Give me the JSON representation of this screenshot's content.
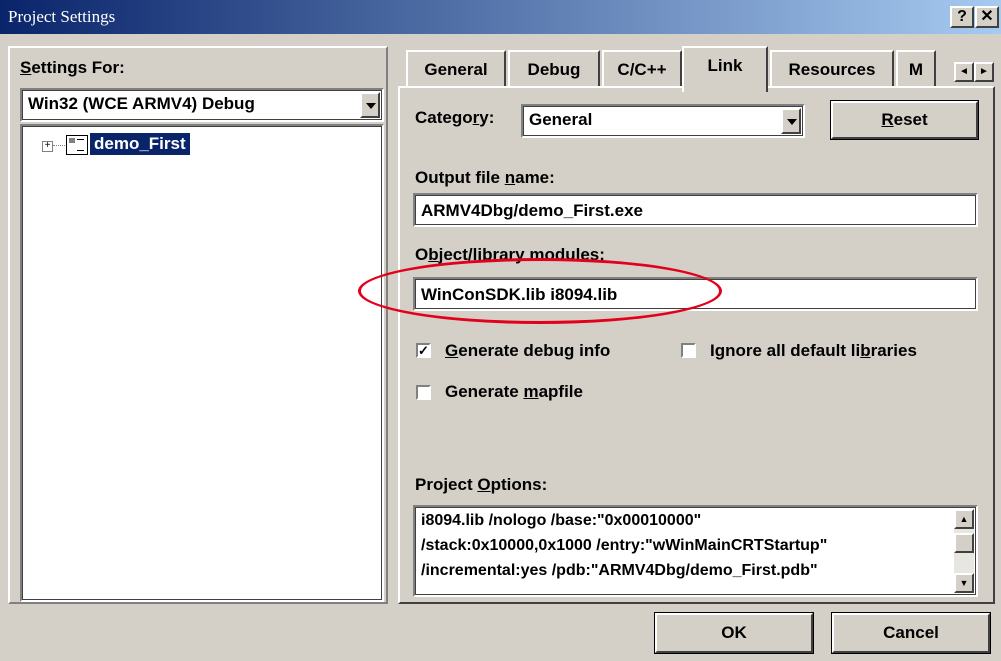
{
  "window": {
    "title": "Project Settings",
    "help_button": "?",
    "close_button": "✕"
  },
  "left": {
    "settings_for_label": "Settings For:",
    "config_value": "Win32 (WCE ARMV4) Debug",
    "tree_item": "demo_First"
  },
  "tabs": [
    {
      "label": "General"
    },
    {
      "label": "Debug"
    },
    {
      "label": "C/C++"
    },
    {
      "label": "Link"
    },
    {
      "label": "Resources"
    },
    {
      "label": "M"
    }
  ],
  "active_tab": "Link",
  "link": {
    "category_label": "Category:",
    "category_value": "General",
    "reset_button": "Reset",
    "output_file_label": "Output file name:",
    "output_file_value": "ARMV4Dbg/demo_First.exe",
    "object_modules_label": "Object/library modules:",
    "object_modules_value": "WinConSDK.lib i8094.lib",
    "generate_debug_label": "Generate debug info",
    "generate_debug_checked": true,
    "ignore_defaults_label": "Ignore all default libraries",
    "ignore_defaults_checked": false,
    "generate_mapfile_label": "Generate mapfile",
    "generate_mapfile_checked": false,
    "project_options_label": "Project Options:",
    "project_options_lines": [
      "i8094.lib /nologo /base:\"0x00010000\"",
      "/stack:0x10000,0x1000 /entry:\"wWinMainCRTStartup\"",
      "/incremental:yes /pdb:\"ARMV4Dbg/demo_First.pdb\""
    ]
  },
  "buttons": {
    "ok": "OK",
    "cancel": "Cancel"
  },
  "colors": {
    "highlight_ellipse": "#e3001b",
    "selection": "#0a246a",
    "face": "#d4d0c8"
  }
}
